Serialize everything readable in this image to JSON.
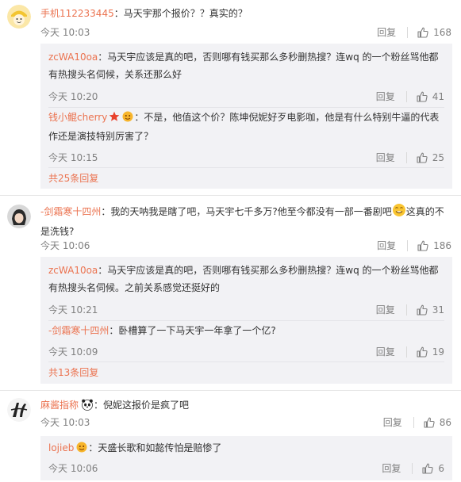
{
  "comments": [
    {
      "username": "手机112233445",
      "text": "：马天宇那个报价？？真实的？",
      "time": "今天 10:03",
      "reply_label": "回复",
      "likes": "168",
      "avatar_icon": "cartoon-avatar-icon",
      "replies": [
        {
          "username": "zcWA10oa",
          "text": "：马天宇应该是真的吧，否则哪有钱买那么多秒删热搜？连wq 的一个粉丝骂他都有热搜头名伺候，关系还那么好",
          "time": "今天 10:20",
          "reply_label": "回复",
          "likes": "41"
        },
        {
          "username": "钱小鲲cherry",
          "text": "：不是，他值这个价？陈坤倪妮好歹电影咖，他是有什么特别牛逼的代表作还是演技特别厉害了？",
          "time": "今天 10:15",
          "reply_label": "回复",
          "likes": "25"
        }
      ],
      "more_replies": "共25条回复"
    },
    {
      "username": "-剑霜寒十四州",
      "text_before": "：我的天呐我是瞎了吧，马天宇七千多万?他至今都没有一部一番剧吧",
      "text_after": "这真的不是洗钱?",
      "time": "今天 10:06",
      "reply_label": "回复",
      "likes": "186",
      "replies": [
        {
          "username": "zcWA10oa",
          "text": "：马天宇应该是真的吧，否则哪有钱买那么多秒删热搜？连wq 的一个粉丝骂他都有热搜头名伺候。之前关系感觉还挺好的",
          "time": "今天 10:21",
          "reply_label": "回复",
          "likes": "31"
        },
        {
          "username": "-剑霜寒十四州",
          "text": "：卧槽算了一下马天宇一年拿了一个亿?",
          "time": "今天 10:09",
          "reply_label": "回复",
          "likes": "19"
        }
      ],
      "more_replies": "共13条回复"
    },
    {
      "username": "麻酱指称",
      "text": "：倪妮这报价是疯了吧",
      "time": "今天 10:03",
      "reply_label": "回复",
      "likes": "86",
      "replies": [
        {
          "username": "lojieb",
          "text": "：天盛长歌和如懿传怕是赔惨了",
          "time": "今天 10:06",
          "reply_label": "回复",
          "likes": "6"
        }
      ]
    }
  ],
  "colors": {
    "username": "#eb7350",
    "meta": "#808080",
    "sub_bg": "#f2f2f5"
  }
}
